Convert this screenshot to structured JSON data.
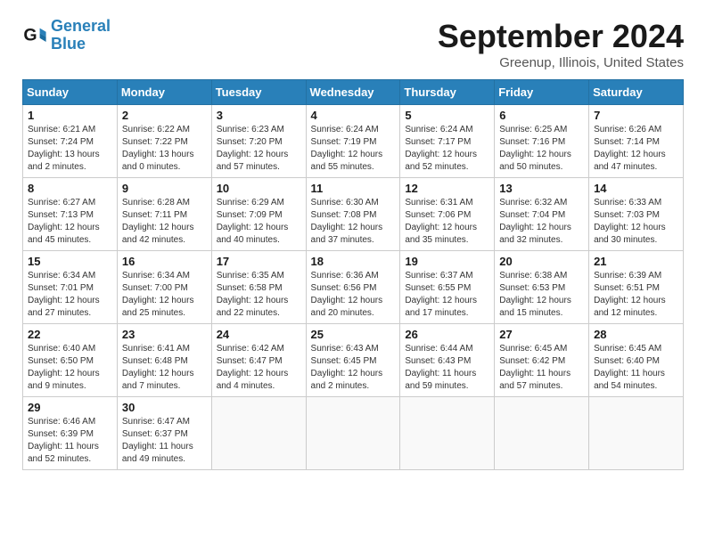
{
  "header": {
    "logo_line1": "General",
    "logo_line2": "Blue",
    "month": "September 2024",
    "location": "Greenup, Illinois, United States"
  },
  "weekdays": [
    "Sunday",
    "Monday",
    "Tuesday",
    "Wednesday",
    "Thursday",
    "Friday",
    "Saturday"
  ],
  "weeks": [
    [
      {
        "day": "1",
        "sunrise": "6:21 AM",
        "sunset": "7:24 PM",
        "daylight": "13 hours and 2 minutes."
      },
      {
        "day": "2",
        "sunrise": "6:22 AM",
        "sunset": "7:22 PM",
        "daylight": "13 hours and 0 minutes."
      },
      {
        "day": "3",
        "sunrise": "6:23 AM",
        "sunset": "7:20 PM",
        "daylight": "12 hours and 57 minutes."
      },
      {
        "day": "4",
        "sunrise": "6:24 AM",
        "sunset": "7:19 PM",
        "daylight": "12 hours and 55 minutes."
      },
      {
        "day": "5",
        "sunrise": "6:24 AM",
        "sunset": "7:17 PM",
        "daylight": "12 hours and 52 minutes."
      },
      {
        "day": "6",
        "sunrise": "6:25 AM",
        "sunset": "7:16 PM",
        "daylight": "12 hours and 50 minutes."
      },
      {
        "day": "7",
        "sunrise": "6:26 AM",
        "sunset": "7:14 PM",
        "daylight": "12 hours and 47 minutes."
      }
    ],
    [
      {
        "day": "8",
        "sunrise": "6:27 AM",
        "sunset": "7:13 PM",
        "daylight": "12 hours and 45 minutes."
      },
      {
        "day": "9",
        "sunrise": "6:28 AM",
        "sunset": "7:11 PM",
        "daylight": "12 hours and 42 minutes."
      },
      {
        "day": "10",
        "sunrise": "6:29 AM",
        "sunset": "7:09 PM",
        "daylight": "12 hours and 40 minutes."
      },
      {
        "day": "11",
        "sunrise": "6:30 AM",
        "sunset": "7:08 PM",
        "daylight": "12 hours and 37 minutes."
      },
      {
        "day": "12",
        "sunrise": "6:31 AM",
        "sunset": "7:06 PM",
        "daylight": "12 hours and 35 minutes."
      },
      {
        "day": "13",
        "sunrise": "6:32 AM",
        "sunset": "7:04 PM",
        "daylight": "12 hours and 32 minutes."
      },
      {
        "day": "14",
        "sunrise": "6:33 AM",
        "sunset": "7:03 PM",
        "daylight": "12 hours and 30 minutes."
      }
    ],
    [
      {
        "day": "15",
        "sunrise": "6:34 AM",
        "sunset": "7:01 PM",
        "daylight": "12 hours and 27 minutes."
      },
      {
        "day": "16",
        "sunrise": "6:34 AM",
        "sunset": "7:00 PM",
        "daylight": "12 hours and 25 minutes."
      },
      {
        "day": "17",
        "sunrise": "6:35 AM",
        "sunset": "6:58 PM",
        "daylight": "12 hours and 22 minutes."
      },
      {
        "day": "18",
        "sunrise": "6:36 AM",
        "sunset": "6:56 PM",
        "daylight": "12 hours and 20 minutes."
      },
      {
        "day": "19",
        "sunrise": "6:37 AM",
        "sunset": "6:55 PM",
        "daylight": "12 hours and 17 minutes."
      },
      {
        "day": "20",
        "sunrise": "6:38 AM",
        "sunset": "6:53 PM",
        "daylight": "12 hours and 15 minutes."
      },
      {
        "day": "21",
        "sunrise": "6:39 AM",
        "sunset": "6:51 PM",
        "daylight": "12 hours and 12 minutes."
      }
    ],
    [
      {
        "day": "22",
        "sunrise": "6:40 AM",
        "sunset": "6:50 PM",
        "daylight": "12 hours and 9 minutes."
      },
      {
        "day": "23",
        "sunrise": "6:41 AM",
        "sunset": "6:48 PM",
        "daylight": "12 hours and 7 minutes."
      },
      {
        "day": "24",
        "sunrise": "6:42 AM",
        "sunset": "6:47 PM",
        "daylight": "12 hours and 4 minutes."
      },
      {
        "day": "25",
        "sunrise": "6:43 AM",
        "sunset": "6:45 PM",
        "daylight": "12 hours and 2 minutes."
      },
      {
        "day": "26",
        "sunrise": "6:44 AM",
        "sunset": "6:43 PM",
        "daylight": "11 hours and 59 minutes."
      },
      {
        "day": "27",
        "sunrise": "6:45 AM",
        "sunset": "6:42 PM",
        "daylight": "11 hours and 57 minutes."
      },
      {
        "day": "28",
        "sunrise": "6:45 AM",
        "sunset": "6:40 PM",
        "daylight": "11 hours and 54 minutes."
      }
    ],
    [
      {
        "day": "29",
        "sunrise": "6:46 AM",
        "sunset": "6:39 PM",
        "daylight": "11 hours and 52 minutes."
      },
      {
        "day": "30",
        "sunrise": "6:47 AM",
        "sunset": "6:37 PM",
        "daylight": "11 hours and 49 minutes."
      },
      null,
      null,
      null,
      null,
      null
    ]
  ]
}
